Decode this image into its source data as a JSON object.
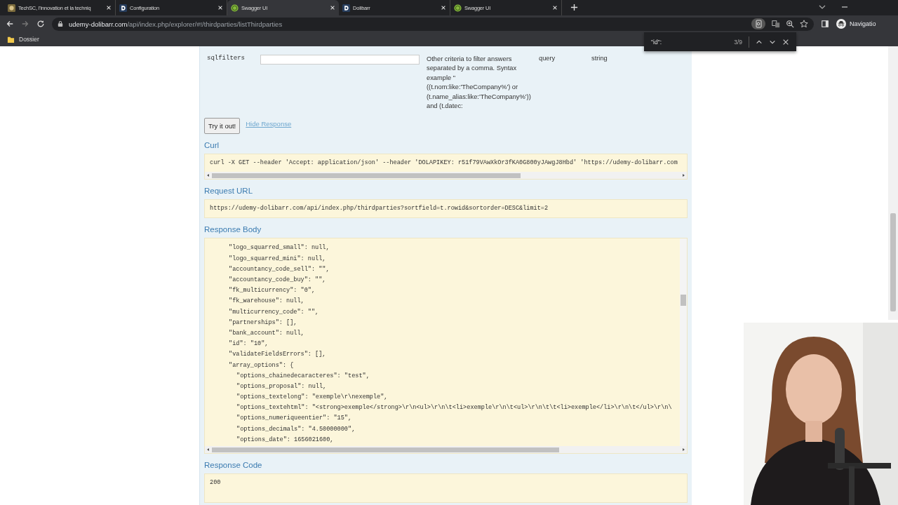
{
  "browser": {
    "tabs": [
      {
        "title": "TechSC, l'innovation et la techniq",
        "kind": "picture",
        "selected": false
      },
      {
        "title": "Configuration",
        "kind": "dolibarr",
        "selected": false
      },
      {
        "title": "Swagger UI",
        "kind": "swagger",
        "selected": true
      },
      {
        "title": "Dolibarr",
        "kind": "dolibarr",
        "selected": false
      },
      {
        "title": "Swagger UI",
        "kind": "swagger",
        "selected": false
      }
    ],
    "url": {
      "host": "udemy-dolibarr.com",
      "path": "/api/index.php/explorer/#!/thirdparties/listThirdparties"
    },
    "profile": "Navigatio",
    "bookmarks": [
      "Dossier"
    ],
    "find": {
      "query": "\"id\":",
      "count": "3/9"
    }
  },
  "parameter": {
    "name": "sqlfilters",
    "description": "Other criteria to filter answers separated by a comma. Syntax example \" ((t.nom:like:'TheCompany%') or (t.name_alias:like:'TheCompany%')) and (t.datec:",
    "param_type": "query",
    "data_type": "string"
  },
  "try_button": "Try it out!",
  "hide_link": "Hide Response",
  "curl": {
    "heading": "Curl",
    "command": "curl -X GET --header 'Accept: application/json' --header 'DOLAPIKEY: r51f79VAwXkOr3fKA0G800yJAwgJ8Hbd' 'https://udemy-dolibarr.com"
  },
  "request_url": {
    "heading": "Request URL",
    "value": "https://udemy-dolibarr.com/api/index.php/thirdparties?sortfield=t.rowid&sortorder=DESC&limit=2"
  },
  "response_body": {
    "heading": "Response Body",
    "lines": [
      {
        "text": "\"logo_squarred_small\": null,"
      },
      {
        "text": "\"logo_squarred_mini\": null,"
      },
      {
        "text": "\"accountancy_code_sell\": \"\","
      },
      {
        "text": "\"accountancy_code_buy\": \"\","
      },
      {
        "text": "\"fk_multicurrency\": \"0\","
      },
      {
        "text": "\"fk_warehouse\": null,"
      },
      {
        "text": "\"multicurrency_code\": \"\","
      },
      {
        "text": "\"partnerships\": [],"
      },
      {
        "text": "\"bank_account\": null,"
      },
      {
        "text": "\"id\": \"10\","
      },
      {
        "text": "\"validateFieldsErrors\": [],"
      },
      {
        "text": "\"array_options\": {",
        "children": [
          {
            "text": "\"options_chainedecaracteres\": \"test\","
          },
          {
            "text": "\"options_proposal\": null,"
          },
          {
            "text": "\"options_textelong\": \"exemple\\r\\nexemple\","
          },
          {
            "text": "\"options_textehtml\": \"<strong>exemple</strong>\\r\\n<ul>\\r\\n\\t<li>exemple\\r\\n\\t<ul>\\r\\n\\t\\t<li>exemple</li>\\r\\n\\t</ul>\\r\\n\\"
          },
          {
            "text": "\"options_numeriqueentier\": \"15\","
          },
          {
            "text": "\"options_decimals\": \"4.50000000\","
          },
          {
            "text": "\"options_date\": 1656021600,"
          }
        ]
      }
    ]
  },
  "response_code": {
    "heading": "Response Code",
    "value": "200"
  }
}
